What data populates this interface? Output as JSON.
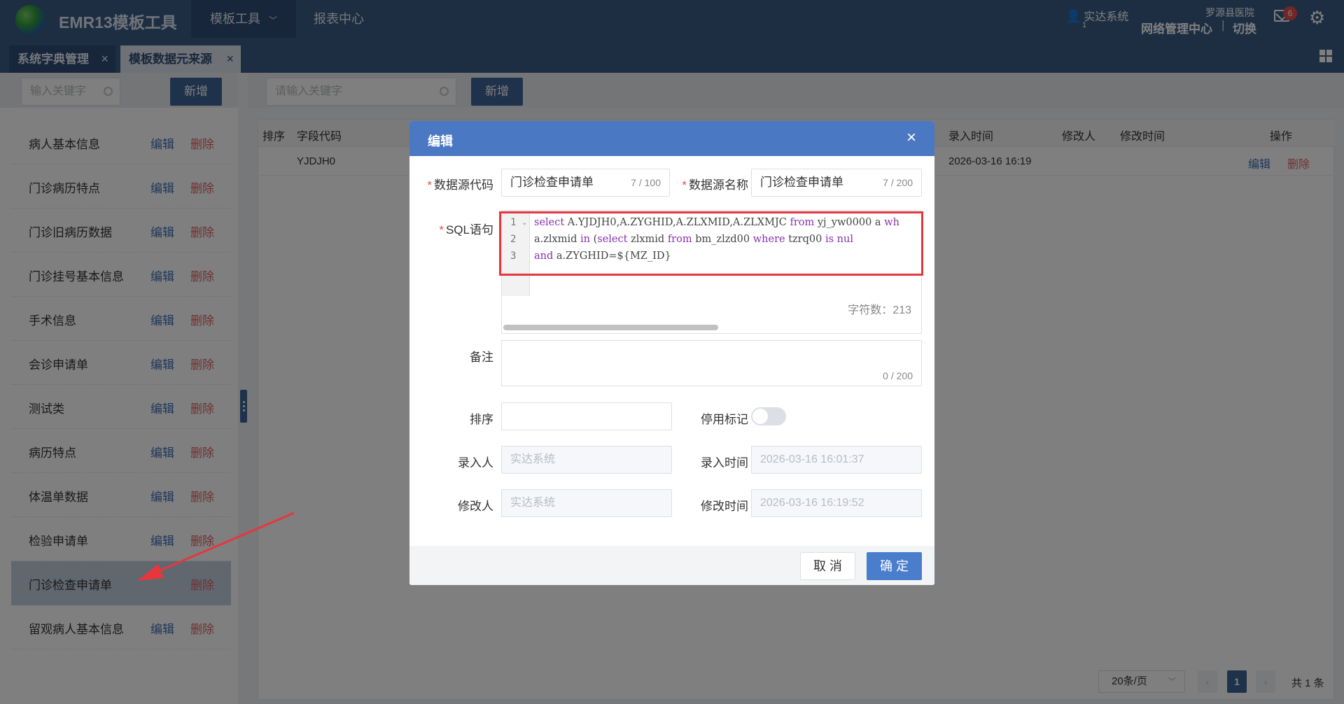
{
  "header": {
    "app_title": "EMR13模板工具",
    "nav": [
      {
        "label": "模板工具"
      },
      {
        "label": "报表中心"
      }
    ],
    "user_name": "实达系统",
    "user_sub": "1",
    "hospital": "罗源县医院",
    "center": "网络管理中心",
    "separator": "|",
    "switch_label": "切换",
    "mail_count": "6"
  },
  "tabs": [
    {
      "label": "系统字典管理",
      "close": "×"
    },
    {
      "label": "模板数据元来源",
      "close": "×"
    }
  ],
  "left": {
    "search_placeholder": "输入关键字",
    "add_label": "新增",
    "items": [
      {
        "name": "病人基本信息",
        "edit": "编辑",
        "del": "删除"
      },
      {
        "name": "门诊病历特点",
        "edit": "编辑",
        "del": "删除"
      },
      {
        "name": "门诊旧病历数据",
        "edit": "编辑",
        "del": "删除"
      },
      {
        "name": "门诊挂号基本信息",
        "edit": "编辑",
        "del": "删除"
      },
      {
        "name": "手术信息",
        "edit": "编辑",
        "del": "删除"
      },
      {
        "name": "会诊申请单",
        "edit": "编辑",
        "del": "删除"
      },
      {
        "name": "测试类",
        "edit": "编辑",
        "del": "删除"
      },
      {
        "name": "病历特点",
        "edit": "编辑",
        "del": "删除"
      },
      {
        "name": "体温单数据",
        "edit": "编辑",
        "del": "删除"
      },
      {
        "name": "检验申请单",
        "edit": "编辑",
        "del": "删除"
      },
      {
        "name": "门诊检查申请单",
        "edit": "",
        "del": "删除"
      },
      {
        "name": "留观病人基本信息",
        "edit": "编辑",
        "del": "删除"
      }
    ]
  },
  "right": {
    "search_placeholder": "请输入关键字",
    "add_label": "新增",
    "columns": {
      "sort": "排序",
      "field_code": "字段代码",
      "entry_time": "录入时间",
      "modifier": "修改人",
      "modify_time": "修改时间",
      "ops": "操作"
    },
    "rows": [
      {
        "field_code": "YJDJH0",
        "entry_time": "2026-03-16 16:19",
        "edit": "编辑",
        "del": "删除"
      }
    ],
    "pager": {
      "page_size": "20条/页",
      "prev": "‹",
      "current": "1",
      "next": "›",
      "total": "共 1 条"
    }
  },
  "modal": {
    "title": "编辑",
    "close": "×",
    "fields": {
      "source_code_label": "数据源代码",
      "source_code_value": "门诊检查申请单",
      "source_code_count": "7 / 100",
      "source_name_label": "数据源名称",
      "source_name_value": "门诊检查申请单",
      "source_name_count": "7 / 200",
      "sql_label": "SQL语句",
      "sql_line_numbers": [
        "1",
        "2",
        "3"
      ],
      "sql_char_count": "字符数：213",
      "remark_label": "备注",
      "remark_count": "0 / 200",
      "sort_label": "排序",
      "sort_value": "",
      "disabled_label": "停用标记",
      "entry_user_label": "录入人",
      "entry_user_value": "实达系统",
      "entry_time_label": "录入时间",
      "entry_time_value": "2026-03-16 16:01:37",
      "modifier_label": "修改人",
      "modifier_value": "实达系统",
      "modify_time_label": "修改时间",
      "modify_time_value": "2026-03-16 16:19:52"
    },
    "sql": {
      "l1_kw1": "select",
      "l1_t1": " A.YJDJH0,A.ZYGHID,A.ZLXMID,A.ZLXMJC ",
      "l1_kw2": "from",
      "l1_t2": " yj_yw0000 a ",
      "l1_kw3": "wh",
      "l2_t1": "a.zlxmid ",
      "l2_kw1": "in",
      "l2_t2": " (",
      "l2_kw2": "select",
      "l2_t3": " zlxmid ",
      "l2_kw3": "from",
      "l2_t4": " bm_zlzd00 ",
      "l2_kw4": "where",
      "l2_t5": " tzrq00 ",
      "l2_kw5": "is",
      "l2_t6": " ",
      "l2_kw6": "nul",
      "l3_kw1": "and",
      "l3_t1": " a.ZYGHID=${MZ_ID}"
    },
    "cancel_label": "取 消",
    "ok_label": "确 定"
  },
  "colors": {
    "header_bg": "#3a5c87",
    "primary": "#4a78c2",
    "danger": "#e06060",
    "highlight_box": "#e5373d"
  },
  "icons": [
    "globe-logo-icon",
    "chevron-down-icon",
    "user-icon",
    "mail-icon",
    "gear-icon",
    "grid-icon",
    "search-icon",
    "close-icon",
    "fold-icon",
    "annotation-arrow-icon"
  ]
}
